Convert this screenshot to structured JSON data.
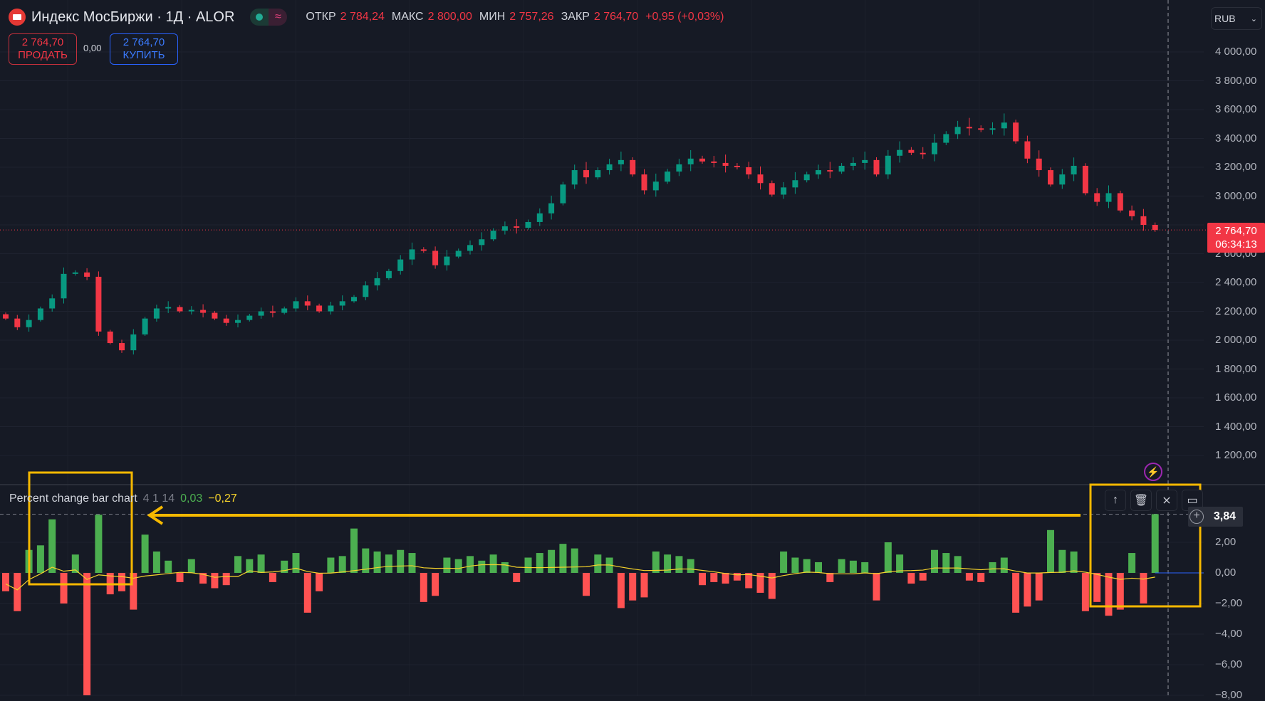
{
  "header": {
    "title": "Индекс МосБиржи · 1Д · ALOR",
    "status_icons": [
      "live-dot-icon",
      "delayed-wave-icon"
    ],
    "ohlc": [
      {
        "label": "ОТКР",
        "value": "2 784,24"
      },
      {
        "label": "МАКС",
        "value": "2 800,00"
      },
      {
        "label": "МИН",
        "value": "2 757,26"
      },
      {
        "label": "ЗАКР",
        "value": "2 764,70"
      }
    ],
    "change": "+0,95 (+0,03%)"
  },
  "trade": {
    "sell_price": "2 764,70",
    "sell_label": "ПРОДАТЬ",
    "spread": "0,00",
    "buy_price": "2 764,70",
    "buy_label": "КУПИТЬ"
  },
  "currency": "RUB",
  "last_price": {
    "value": "2 764,70",
    "countdown": "06:34:13"
  },
  "colors": {
    "up": "#089981",
    "down": "#f23645",
    "bar_up": "#4caf50",
    "bar_down": "#ff5252",
    "ma": "#f5d22b",
    "annotation": "#f5b800"
  },
  "indicator": {
    "name": "Percent change bar chart",
    "params": "4 1 14",
    "value1": "0,03",
    "value2": "−0,27",
    "last_value": "3,84",
    "toolbar": [
      "arrow-up-icon",
      "trash-icon",
      "collapse-icon",
      "maximize-icon"
    ]
  },
  "chart_data": [
    {
      "type": "candlestick",
      "ylim": [
        1100,
        4100
      ],
      "yticks": [
        "4 000,00",
        "3 800,00",
        "3 600,00",
        "3 400,00",
        "3 200,00",
        "3 000,00",
        "2 600,00",
        "2 400,00",
        "2 200,00",
        "2 000,00",
        "1 800,00",
        "1 600,00",
        "1 400,00",
        "1 200,00"
      ],
      "close": [
        2150,
        2090,
        2140,
        2220,
        2290,
        2460,
        2470,
        2440,
        2060,
        1980,
        1930,
        2040,
        2150,
        2220,
        2230,
        2200,
        2210,
        2190,
        2150,
        2120,
        2140,
        2170,
        2200,
        2190,
        2220,
        2270,
        2240,
        2200,
        2240,
        2270,
        2300,
        2380,
        2430,
        2480,
        2560,
        2630,
        2620,
        2520,
        2580,
        2620,
        2660,
        2700,
        2760,
        2790,
        2780,
        2820,
        2880,
        2950,
        3080,
        3180,
        3130,
        3180,
        3220,
        3250,
        3150,
        3040,
        3100,
        3170,
        3220,
        3260,
        3240,
        3230,
        3210,
        3200,
        3150,
        3090,
        3010,
        3060,
        3110,
        3150,
        3180,
        3170,
        3210,
        3230,
        3250,
        3150,
        3280,
        3320,
        3300,
        3290,
        3370,
        3430,
        3480,
        3470,
        3460,
        3470,
        3510,
        3380,
        3260,
        3180,
        3080,
        3150,
        3210,
        3020,
        2960,
        3020,
        2900,
        2860,
        2800,
        2764.7
      ]
    },
    {
      "type": "bar",
      "title": "Percent change bar chart",
      "ylim": [
        -8,
        4
      ],
      "yticks": [
        "2,00",
        "0,00",
        "−2,00",
        "−4,00",
        "−6,00",
        "−8,00"
      ],
      "values": [
        -1.2,
        -2.5,
        1.5,
        1.8,
        3.5,
        -2.0,
        1.2,
        -8.0,
        3.8,
        -1.4,
        -1.2,
        -2.4,
        2.5,
        1.4,
        0.8,
        -0.6,
        0.9,
        -0.7,
        -1.0,
        -0.8,
        1.1,
        0.9,
        1.2,
        -0.6,
        0.8,
        1.3,
        -2.6,
        -1.2,
        1.0,
        1.1,
        2.9,
        1.6,
        1.4,
        1.2,
        1.5,
        1.3,
        -1.9,
        -1.5,
        1.0,
        0.9,
        1.1,
        0.8,
        1.2,
        0.7,
        -0.6,
        1.0,
        1.3,
        1.5,
        1.9,
        1.6,
        -1.5,
        1.2,
        1.0,
        -2.3,
        -1.8,
        -1.6,
        1.4,
        1.2,
        1.1,
        0.9,
        -0.8,
        -0.6,
        -0.7,
        -0.5,
        -1.0,
        -1.3,
        -1.7,
        1.4,
        1.0,
        0.9,
        0.7,
        -0.6,
        0.9,
        0.8,
        0.7,
        -1.8,
        2.0,
        1.2,
        -0.7,
        -0.5,
        1.5,
        1.3,
        1.1,
        -0.5,
        -0.6,
        0.7,
        1.0,
        -2.6,
        -2.2,
        -1.8,
        2.8,
        1.5,
        1.4,
        -2.5,
        -1.9,
        -2.8,
        -2.4,
        1.3,
        -2.0,
        3.84
      ]
    }
  ]
}
